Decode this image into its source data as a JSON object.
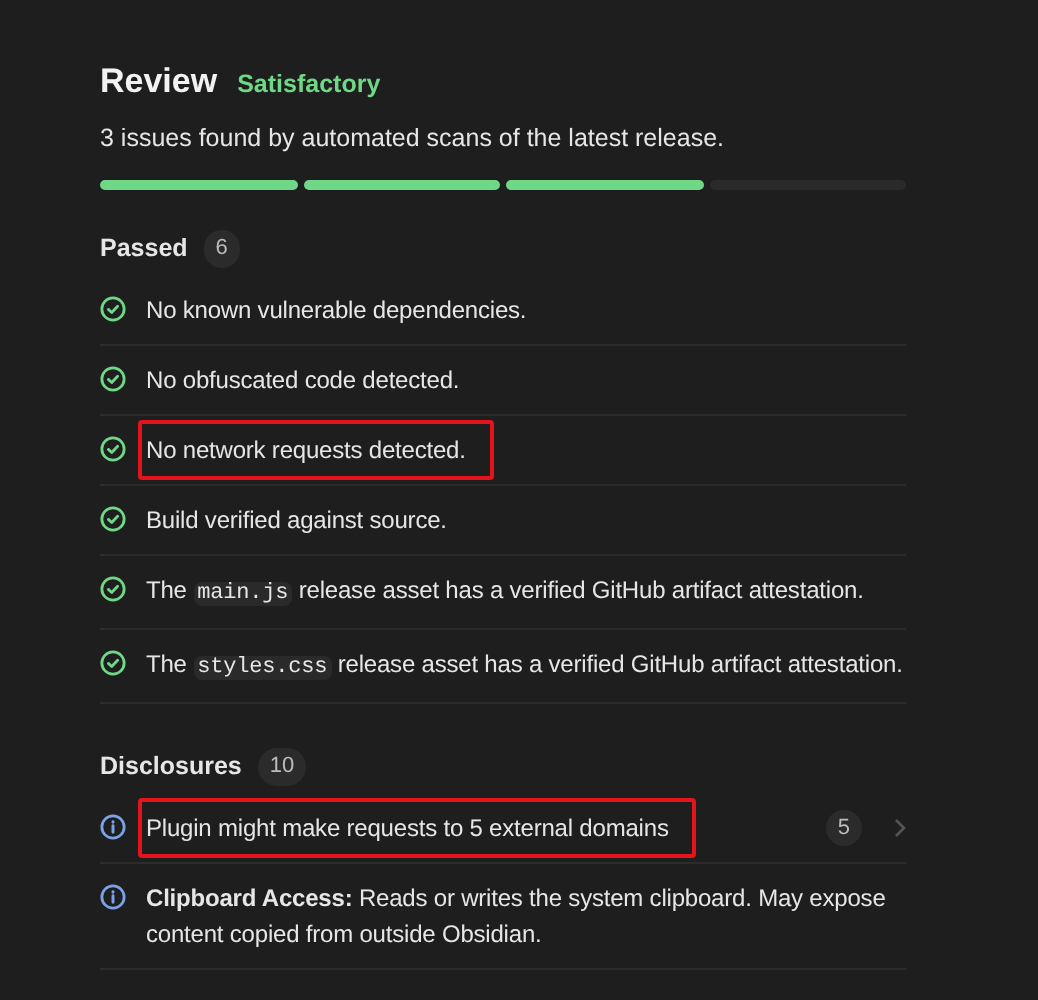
{
  "header": {
    "title": "Review",
    "rating": "Satisfactory",
    "summary": "3 issues found by automated scans of the latest release.",
    "segments": [
      {
        "filled": true
      },
      {
        "filled": true
      },
      {
        "filled": true
      },
      {
        "filled": false
      }
    ]
  },
  "sections": [
    {
      "title": "Passed",
      "count": "6",
      "items": [
        {
          "kind": "pass",
          "highlighted": false,
          "parts": [
            {
              "kind": "text",
              "text": "No known vulnerable dependencies."
            }
          ]
        },
        {
          "kind": "pass",
          "highlighted": false,
          "parts": [
            {
              "kind": "text",
              "text": "No obfuscated code detected."
            }
          ]
        },
        {
          "kind": "pass",
          "highlighted": true,
          "parts": [
            {
              "kind": "text",
              "text": "No network requests detected."
            }
          ]
        },
        {
          "kind": "pass",
          "highlighted": false,
          "parts": [
            {
              "kind": "text",
              "text": "Build verified against source."
            }
          ]
        },
        {
          "kind": "pass",
          "highlighted": false,
          "parts": [
            {
              "kind": "text",
              "text": "The "
            },
            {
              "kind": "code",
              "text": "main.js"
            },
            {
              "kind": "text",
              "text": " release asset has a verified GitHub artifact attestation."
            }
          ]
        },
        {
          "kind": "pass",
          "highlighted": false,
          "parts": [
            {
              "kind": "text",
              "text": "The "
            },
            {
              "kind": "code",
              "text": "styles.css"
            },
            {
              "kind": "text",
              "text": " release asset has a verified GitHub artifact attestation."
            }
          ]
        }
      ]
    },
    {
      "title": "Disclosures",
      "count": "10",
      "items": [
        {
          "kind": "info",
          "highlighted": true,
          "count": "5",
          "parts": [
            {
              "kind": "text",
              "text": "Plugin might make requests to 5 external domains"
            }
          ]
        },
        {
          "kind": "info",
          "highlighted": false,
          "parts": [
            {
              "kind": "text",
              "text": "**Clipboard Access:** Reads or writes the system clipboard. May expose content copied from outside Obsidian."
            }
          ]
        }
      ]
    }
  ]
}
